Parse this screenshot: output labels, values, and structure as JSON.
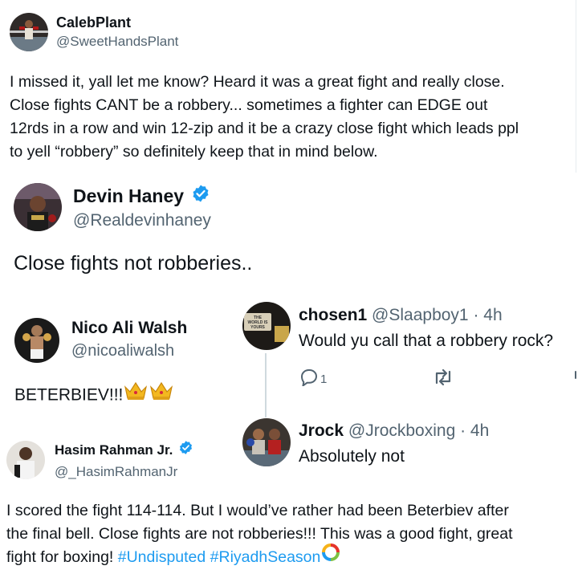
{
  "tweet1": {
    "name": "CalebPlant",
    "handle": "@SweetHandsPlant",
    "lines": [
      "I missed it, yall let me know? Heard it was a great fight and really close.",
      "Close fights CANT be a robbery... sometimes a fighter can EDGE out",
      "12rds in a row and win 12-zip and it be a crazy close fight which leads ppl",
      "to yell “robbery” so definitely keep that in mind below."
    ]
  },
  "tweet2": {
    "name": "Devin Haney",
    "handle": "@Realdevinhaney",
    "text": "Close fights not robberies.."
  },
  "tweet3": {
    "name": "Nico Ali Walsh",
    "handle": "@nicoaliwalsh",
    "text": "BETERBIEV!!!"
  },
  "reply1": {
    "name": "chosen1",
    "handle": "@Slaapboy1",
    "time": "· 4h",
    "text": "Would yu call that a robbery rock?",
    "reply_count": "1",
    "avatar_sign_text": "THE WORLD IS YOURS"
  },
  "reply2": {
    "name": "Jrock",
    "handle": "@Jrockboxing",
    "time": "· 4h",
    "text": "Absolutely not"
  },
  "tweet4": {
    "name": "Hasim Rahman Jr.",
    "handle": "@_HasimRahmanJr",
    "line1": "I scored the fight 114-114. But I would’ve rather had been Beterbiev after",
    "line2": "the final bell. Close fights are not robberies!!! This was a good fight, great",
    "line3_prefix": "fight for boxing! ",
    "hashtags": [
      "#Undisputed",
      "#RiyadhSeason"
    ]
  },
  "colors": {
    "verified": "#1d9bf0",
    "hashtag": "#1d9bf0",
    "muted": "#536471",
    "divider": "#cfd9de"
  }
}
